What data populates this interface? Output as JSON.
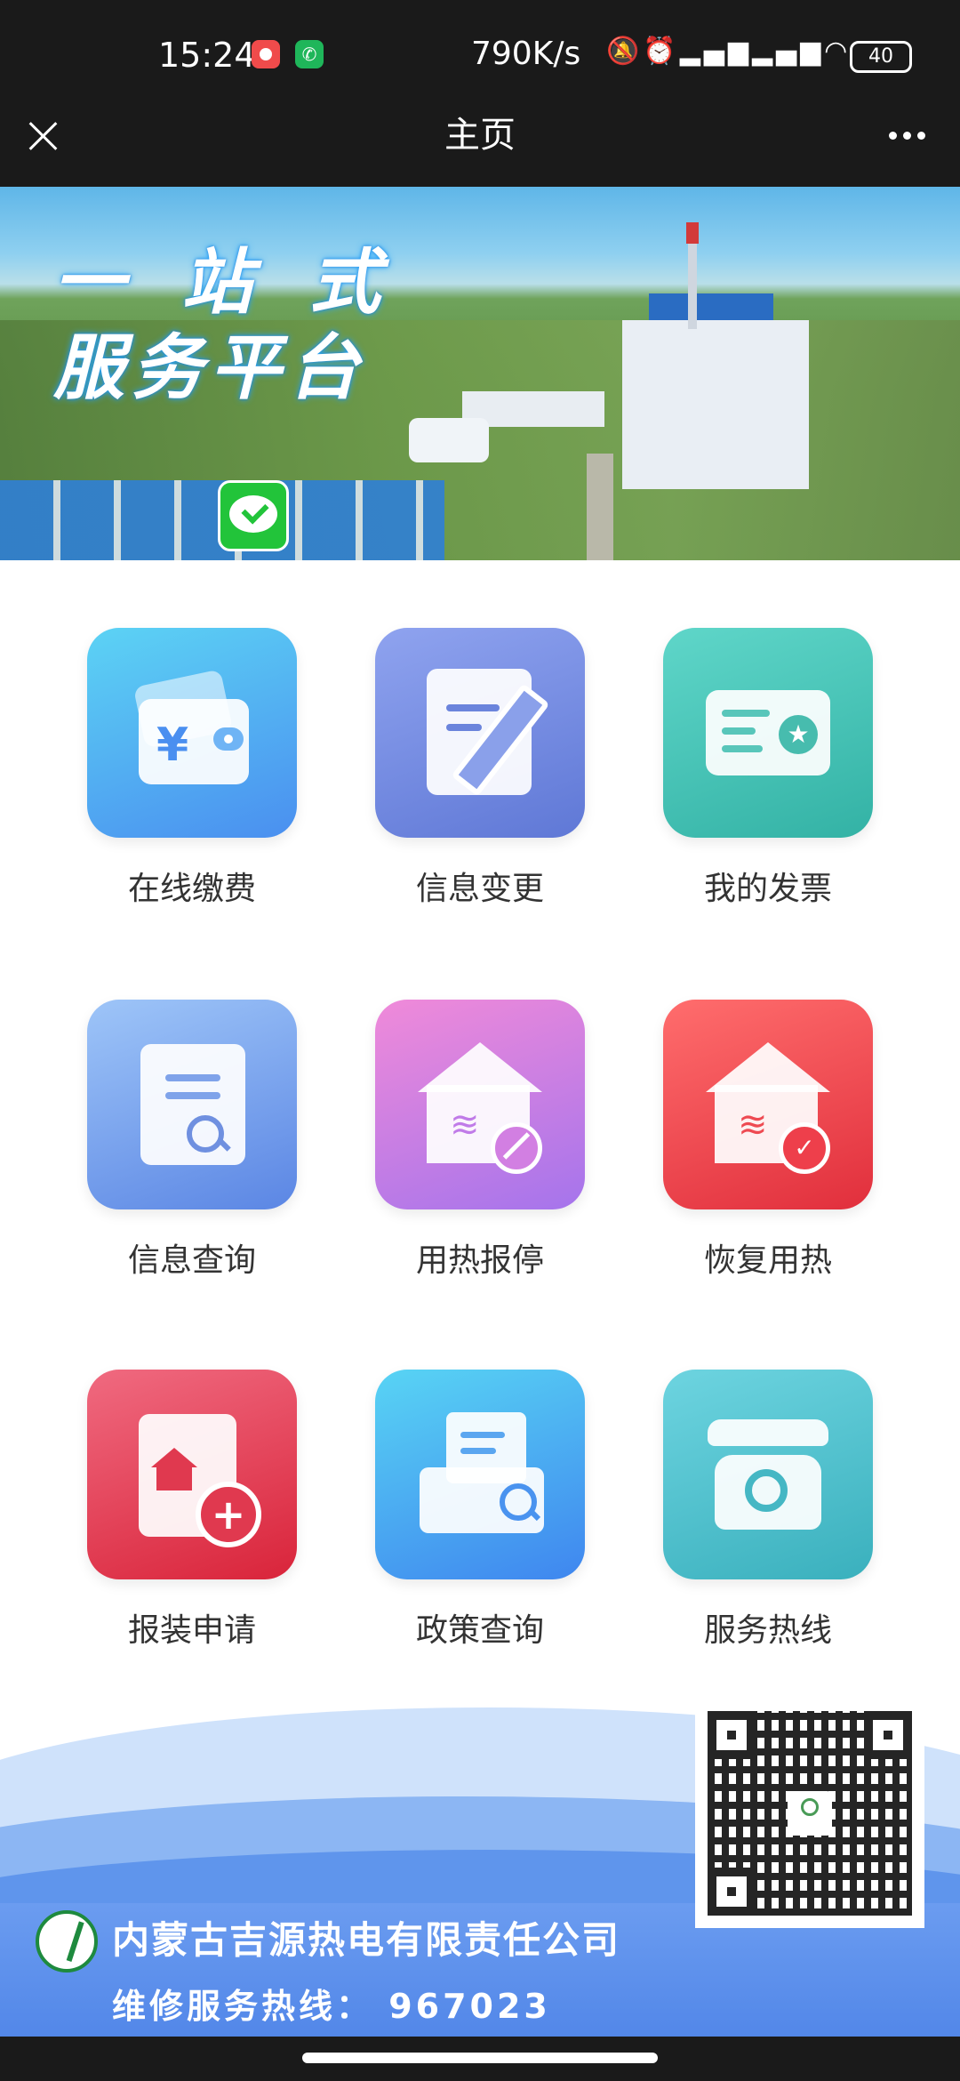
{
  "status_bar": {
    "time": "15:24",
    "net_speed": "790K/s",
    "battery": "40",
    "icons": [
      "silent-icon",
      "alarm-icon",
      "hd-signal-icon",
      "hd-signal-icon",
      "wifi-icon"
    ]
  },
  "header": {
    "title": "主页"
  },
  "banner": {
    "line1": "一站式",
    "line2": "服务平台"
  },
  "grid": [
    {
      "label": "在线缴费",
      "icon": "wallet-icon"
    },
    {
      "label": "信息变更",
      "icon": "edit-document-icon"
    },
    {
      "label": "我的发票",
      "icon": "invoice-card-icon"
    },
    {
      "label": "信息查询",
      "icon": "document-search-icon"
    },
    {
      "label": "用热报停",
      "icon": "heating-stop-icon"
    },
    {
      "label": "恢复用热",
      "icon": "heating-resume-icon"
    },
    {
      "label": "报装申请",
      "icon": "install-apply-icon"
    },
    {
      "label": "政策查询",
      "icon": "folder-search-icon"
    },
    {
      "label": "服务热线",
      "icon": "telephone-icon"
    }
  ],
  "footer": {
    "company": "内蒙古吉源热电有限责任公司",
    "hotline": "维修服务热线：  967023"
  },
  "colors": {
    "header_bg": "#1a1a1a",
    "footer_wave": "#5f95ec"
  }
}
